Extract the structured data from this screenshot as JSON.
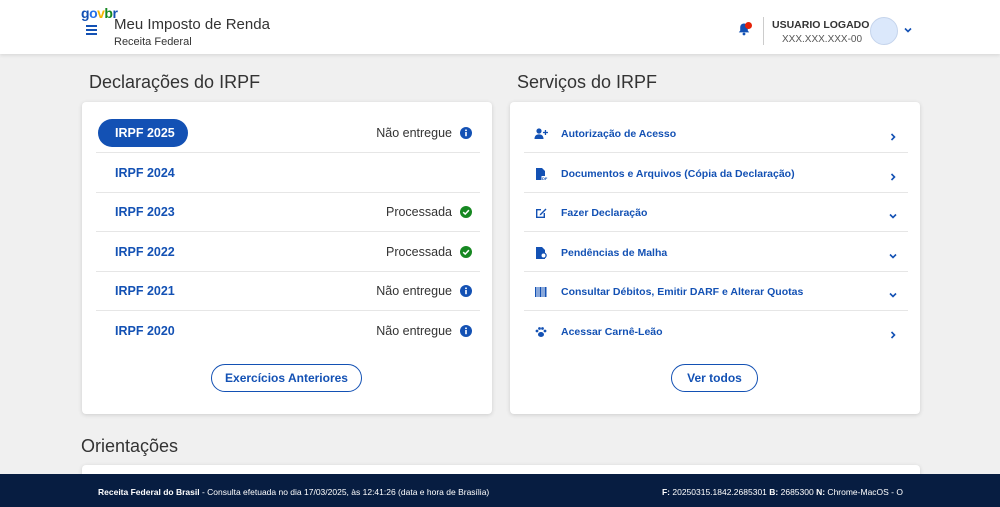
{
  "header": {
    "logo": {
      "g": "g",
      "o": "o",
      "v": "v",
      "b": "b",
      "r": "r"
    },
    "app_title": "Meu Imposto de Renda",
    "app_subtitle": "Receita Federal",
    "user_name": "USUARIO LOGADO",
    "user_cpf": "XXX.XXX.XXX-00",
    "notification_color": "#e52207"
  },
  "declaracoes": {
    "title": "Declarações do IRPF",
    "rows": [
      {
        "year": "IRPF 2025",
        "status": "Não entregue",
        "icon": "info-icon",
        "selected": true
      },
      {
        "year": "IRPF 2024",
        "status": "",
        "icon": "",
        "selected": false
      },
      {
        "year": "IRPF 2023",
        "status": "Processada",
        "icon": "check-icon",
        "selected": false
      },
      {
        "year": "IRPF 2022",
        "status": "Processada",
        "icon": "check-icon",
        "selected": false
      },
      {
        "year": "IRPF 2021",
        "status": "Não entregue",
        "icon": "info-icon",
        "selected": false
      },
      {
        "year": "IRPF 2020",
        "status": "Não entregue",
        "icon": "info-icon",
        "selected": false
      }
    ],
    "button_label": "Exercícios Anteriores"
  },
  "servicos": {
    "title": "Serviços do IRPF",
    "items": [
      {
        "label": "Autorização de Acesso",
        "icon": "user-plus-icon",
        "chevron": "chevron-right-icon"
      },
      {
        "label": "Documentos e Arquivos (Cópia da Declaração)",
        "icon": "document-icon",
        "chevron": "chevron-right-icon"
      },
      {
        "label": "Fazer Declaração",
        "icon": "edit-icon",
        "chevron": "chevron-down-icon"
      },
      {
        "label": "Pendências de Malha",
        "icon": "file-search-icon",
        "chevron": "chevron-down-icon"
      },
      {
        "label": "Consultar Débitos, Emitir DARF e Alterar Quotas",
        "icon": "barcode-icon",
        "chevron": "chevron-down-icon"
      },
      {
        "label": "Acessar Carnê-Leão",
        "icon": "paw-icon",
        "chevron": "chevron-right-icon"
      }
    ],
    "button_label": "Ver todos"
  },
  "orientacoes": {
    "title": "Orientações"
  },
  "footer": {
    "org": "Receita Federal do Brasil",
    "consulta": " - Consulta efetuada no dia 17/03/2025, às 12:41:26 (data e hora de Brasília)",
    "f_label": "F:",
    "f_value": " 20250315.1842.2685301 ",
    "b_label": "B:",
    "b_value": " 2685300 ",
    "n_label": "N:",
    "n_value": " Chrome-MacOS - O"
  },
  "colors": {
    "primary": "#1351b4",
    "success": "#168821",
    "footer_bg": "#071d41"
  }
}
